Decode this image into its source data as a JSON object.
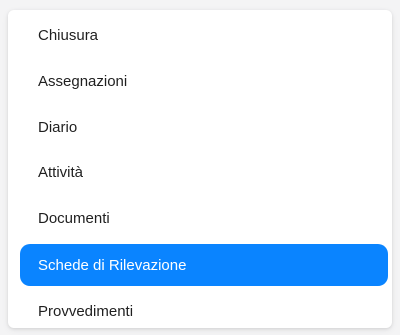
{
  "menu": {
    "items": [
      {
        "label": "Chiusura",
        "active": false
      },
      {
        "label": "Assegnazioni",
        "active": false
      },
      {
        "label": "Diario",
        "active": false
      },
      {
        "label": "Attività",
        "active": false
      },
      {
        "label": "Documenti",
        "active": false
      },
      {
        "label": "Schede di Rilevazione",
        "active": true
      },
      {
        "label": "Provvedimenti",
        "active": false
      }
    ]
  },
  "colors": {
    "accent": "#0a84ff",
    "text": "#1f1f1f",
    "active_text": "#ffffff"
  }
}
